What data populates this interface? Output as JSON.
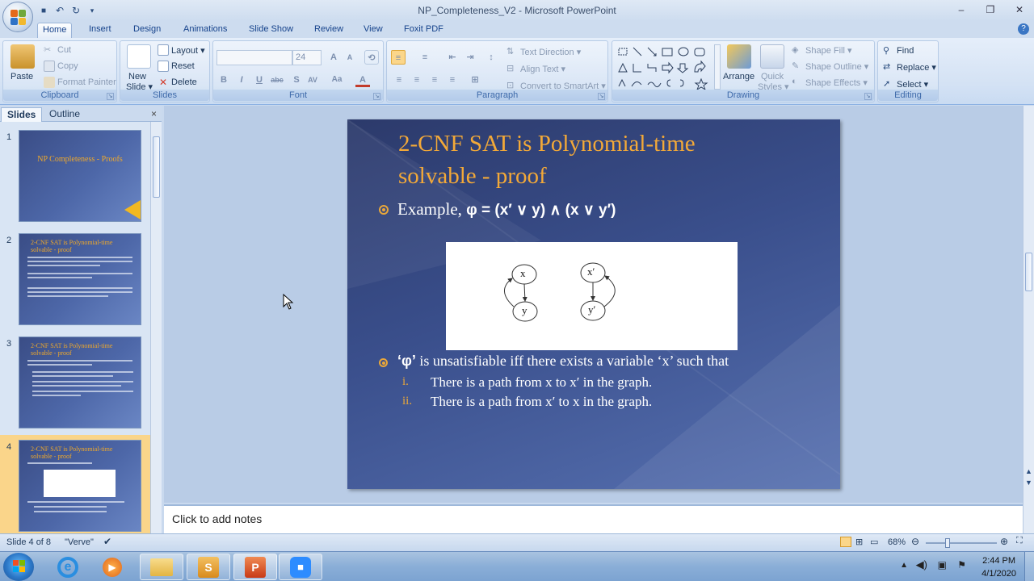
{
  "window": {
    "title": "NP_Completeness_V2 - Microsoft PowerPoint",
    "minimize": "–",
    "restore": "❐",
    "close": "✕"
  },
  "qat": {
    "save": "■",
    "undo": "↶",
    "redo": "↻",
    "more": "▾"
  },
  "tabs": [
    "Home",
    "Insert",
    "Design",
    "Animations",
    "Slide Show",
    "Review",
    "View",
    "Foxit PDF"
  ],
  "ribbon": {
    "clipboard": {
      "label": "Clipboard",
      "paste": "Paste",
      "cut": "Cut",
      "copy": "Copy",
      "format_painter": "Format Painter"
    },
    "slides": {
      "label": "Slides",
      "new_slide": "New",
      "new_slide2": "Slide ▾",
      "layout": "Layout ▾",
      "reset": "Reset",
      "delete": "Delete"
    },
    "font": {
      "label": "Font",
      "font_name": "",
      "font_size": "24"
    },
    "paragraph": {
      "label": "Paragraph",
      "text_direction": "Text Direction ▾",
      "align_text": "Align Text ▾",
      "convert_smartart": "Convert to SmartArt ▾"
    },
    "drawing": {
      "label": "Drawing",
      "arrange": "Arrange",
      "quick_styles": "Quick",
      "quick_styles2": "Styles ▾",
      "shape_fill": "Shape Fill ▾",
      "shape_outline": "Shape Outline ▾",
      "shape_effects": "Shape Effects ▾"
    },
    "editing": {
      "label": "Editing",
      "find": "Find",
      "replace": "Replace ▾",
      "select": "Select ▾"
    }
  },
  "left_pane": {
    "tab_slides": "Slides",
    "tab_outline": "Outline",
    "close": "×",
    "thumbs": [
      {
        "num": "1",
        "title": "NP Completeness - Proofs"
      },
      {
        "num": "2",
        "title": "2-CNF SAT is Polynomial-time solvable - proof"
      },
      {
        "num": "3",
        "title": "2-CNF SAT is Polynomial-time solvable - proof"
      },
      {
        "num": "4",
        "title": "2-CNF SAT is Polynomial-time solvable - proof"
      }
    ]
  },
  "slide": {
    "title_line1": "2-CNF SAT is Polynomial-time",
    "title_line2": "solvable - proof",
    "example_label": "Example, ",
    "example_formula": "φ = (x′ ∨ y) ∧ (x ∨ y′)",
    "graph": {
      "nodes_left": [
        "x",
        "y"
      ],
      "nodes_right": [
        "x′",
        "y′"
      ]
    },
    "statement_q": "‘φ’",
    "statement_rest": " is unsatisfiable iff  there exists a variable ‘x’ such that",
    "items": [
      {
        "num": "i.",
        "text": "There is a path from x to x′ in the graph."
      },
      {
        "num": "ii.",
        "text": "There is a path from x′ to x in the graph."
      }
    ]
  },
  "notes": {
    "placeholder": "Click to add notes"
  },
  "status": {
    "slide_of": "Slide 4 of 8",
    "theme": "\"Verve\"",
    "zoom": "68%"
  },
  "taskbar": {
    "time": "2:44 PM",
    "date": "4/1/2020"
  },
  "colors": {
    "title_orange": "#f3a938",
    "accent": "#e9a73a",
    "ribbon_blue": "#d4e2f4"
  }
}
